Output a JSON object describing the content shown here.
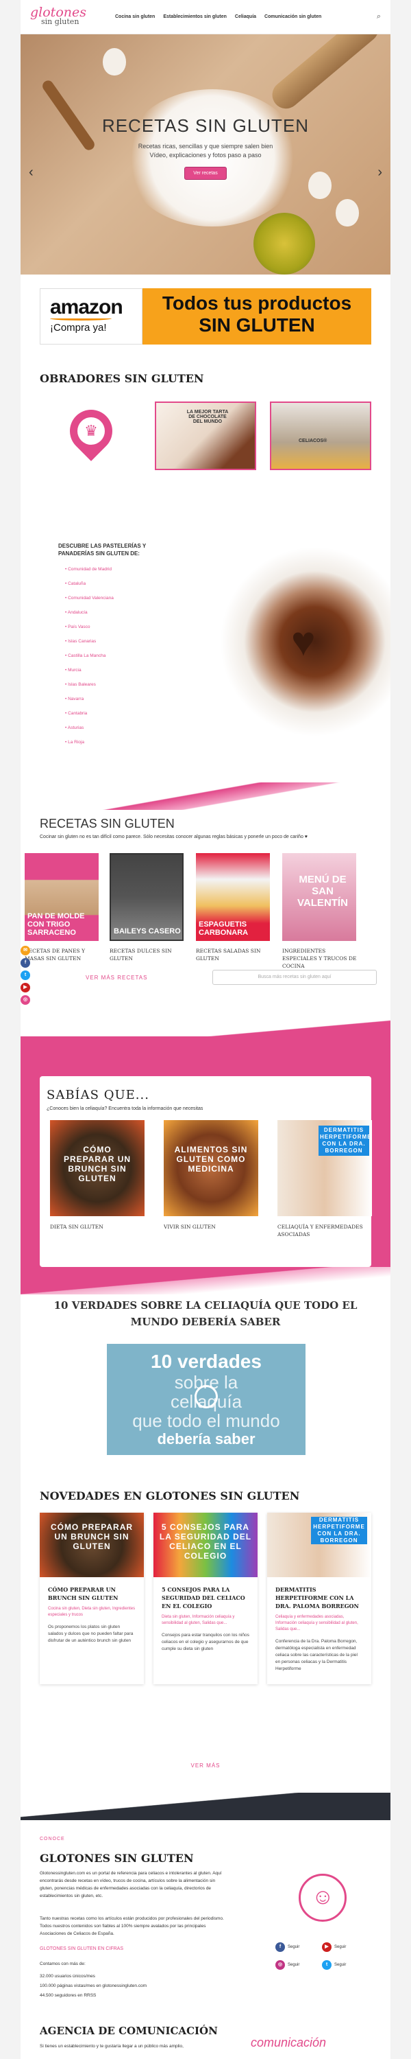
{
  "header": {
    "logo_main": "glotones",
    "logo_sub": "sin gluten",
    "nav": [
      "Cocina sin gluten",
      "Establecimientos sin gluten",
      "Celiaquía",
      "Comunicación sin gluten"
    ]
  },
  "hero": {
    "title": "RECETAS SIN GLUTEN",
    "subtitle_1": "Recetas ricas, sencillas y que siempre salen bien",
    "subtitle_2": "Vídeo, explicaciones y fotos paso a paso",
    "button": "Ver recetas"
  },
  "amazon": {
    "logo": "amazon",
    "cta": "¡Compra ya!",
    "headline_1": "Todos tus productos",
    "headline_2": "SIN GLUTEN"
  },
  "obradores": {
    "title": "OBRADORES SIN GLUTEN",
    "cake_caption": "LA MEJOR TARTA DE CHOCOLATE DEL MUNDO",
    "celiacos_caption": "CELIACOS®",
    "pastry_heading": "DESCUBRE LAS PASTELERÍAS Y PANADERÍAS SIN GLUTEN DE:",
    "regions": [
      "Comunidad de Madrid",
      "Cataluña",
      "Comunidad Valenciana",
      "Andalucía",
      "País Vasco",
      "Islas Canarias",
      "Castilla La Mancha",
      "Murcia",
      "Islas Baleares",
      "Navarra",
      "Cantabria",
      "Asturias",
      "La Rioja"
    ]
  },
  "recetas": {
    "title": "RECETAS SIN GLUTEN",
    "intro": "Cocinar sin gluten no es tan difícil como parece. Sólo necesitas conocer algunas reglas básicas y ponerle un poco de cariño ♥",
    "tiles": [
      {
        "image_text": "PAN DE MOLDE CON TRIGO SARRACENO",
        "caption": "RECETAS DE PANES Y MASAS SIN GLUTEN"
      },
      {
        "image_text": "BAILEYS CASERO",
        "caption": "RECETAS DULCES SIN GLUTEN"
      },
      {
        "image_text": "ESPAGUETIS CARBONARA",
        "caption": "RECETAS SALADAS SIN GLUTEN"
      },
      {
        "image_text": "MENÚ DE SAN VALENTÍN",
        "caption": "INGREDIENTES ESPECIALES Y TRUCOS DE COCINA"
      }
    ],
    "more": "VER MÁS RECETAS",
    "search_placeholder": "Busca más recetas sin gluten aquí"
  },
  "sabias": {
    "title": "SABÍAS QUE...",
    "subtitle": "¿Conoces bien la celiaquía? Encuentra toda la información que necesitas",
    "tiles": [
      {
        "image_text": "CÓMO PREPARAR UN BRUNCH SIN GLUTEN",
        "caption": "DIETA SIN GLUTEN"
      },
      {
        "image_text": "ALIMENTOS SIN GLUTEN COMO MEDICINA",
        "caption": "VIVIR SIN GLUTEN"
      },
      {
        "image_text": "DERMATITIS HERPETIFORME CON LA DRA. BORREGON",
        "caption": "CELIAQUÍA Y ENFERMEDADES ASOCIADAS"
      }
    ]
  },
  "verdades": {
    "title": "10 VERDADES SOBRE LA CELIAQUÍA QUE TODO EL MUNDO DEBERÍA SABER",
    "video_1": "10 verdades",
    "video_2": "sobre la",
    "video_3": "celiaquía",
    "video_4": "que todo el mundo",
    "video_5": "debería saber"
  },
  "novedades": {
    "title": "NOVEDADES EN GLOTONES SIN GLUTEN",
    "posts": [
      {
        "image_text": "CÓMO PREPARAR UN BRUNCH SIN GLUTEN",
        "title": "CÓMO PREPARAR UN BRUNCH SIN GLUTEN",
        "cats": "Cocina sin gluten, Dieta sin gluten, Ingredientes especiales y trucos",
        "excerpt": "Os proponemos los platos sin gluten salados y dulces que no pueden faltar para disfrutar de un auténtico brunch sin gluten"
      },
      {
        "image_text": "5 CONSEJOS PARA LA SEGURIDAD DEL CELIACO EN EL COLEGIO",
        "title": "5 CONSEJOS PARA LA SEGURIDAD DEL CELIACO EN EL COLEGIO",
        "cats": "Dieta sin gluten, Información celiaquía y sensibilidad al gluten, Salidas que...",
        "excerpt": "Consejos para estar tranquilos con los niños celiacos en el colegio y asegurarnos de que cumple su dieta sin gluten"
      },
      {
        "image_text": "DERMATITIS HERPETIFORME CON LA DRA. BORREGON",
        "title": "DERMATITIS HERPETIFORME CON LA DRA. PALOMA BORREGON",
        "cats": "Celiaquía y enfermedades asociadas, Información celiaquía y sensibilidad al gluten, Salidas que...",
        "excerpt": "Conferencia de la Dra. Paloma Borregon, dermatóloga especialista en enfermedad celiaca sobre las características de la piel en personas celiacas y la Dermatitis Herpetiforme"
      }
    ],
    "more": "VER MÁS"
  },
  "footer": {
    "kicker": "CONOCE",
    "title": "GLOTONES SIN GLUTEN",
    "p1": "Glotonessingluten.com es un portal de referencia para celiacos e intolerantes al gluten. Aquí encontrarás desde recetas en vídeo, trucos de cocina, artículos sobre la alimentación sin gluten, ponencias médicas de enfermedades asociadas con la celiaquía, directorios de establecimientos sin gluten, etc.",
    "p2": "Tanto nuestras recetas como los artículos están producidos por profesionales del periodismo. Todos nuestros contenidos son fiables al 100% siempre avalados por las principales Asociaciones de Celiacos de España.",
    "cifras_title": "GLOTONES SIN GLUTEN EN CIFRAS",
    "cifras_intro": "Contamos con más de:",
    "cifras": [
      "32.000 usuarios únicos/mes",
      "100.000 páginas vistas/mes en glotonessingluten.com",
      "44.500 seguidores en RRSS"
    ],
    "social": [
      {
        "label": "Seguir",
        "color": "#3b5998",
        "glyph": "f"
      },
      {
        "label": "Seguir",
        "color": "#cd201f",
        "glyph": "▶"
      },
      {
        "label": "Seguir",
        "color": "#c13584",
        "glyph": "◎"
      },
      {
        "label": "Seguir",
        "color": "#1da1f2",
        "glyph": "t"
      }
    ],
    "agencia_title": "AGENCIA DE COMUNICACIÓN",
    "agencia_p": "Si tienes un establecimiento y te gustaría llegar a un público más amplio,",
    "comunicacion_logo": "comunicación"
  },
  "floating_social": [
    {
      "color": "#f7a21b",
      "glyph": "✉"
    },
    {
      "color": "#3b5998",
      "glyph": "f"
    },
    {
      "color": "#1da1f2",
      "glyph": "t"
    },
    {
      "color": "#cd201f",
      "glyph": "▶"
    },
    {
      "color": "#e2498a",
      "glyph": "◎"
    }
  ],
  "accent": "#e2498a"
}
